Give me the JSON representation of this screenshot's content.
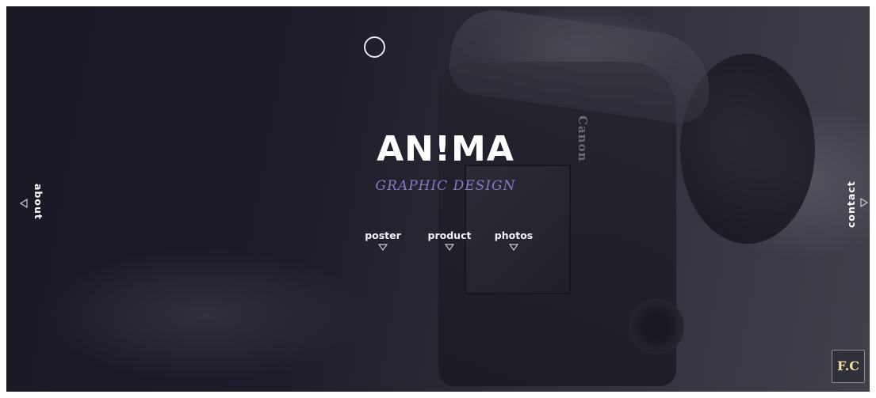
{
  "brand": {
    "logo_text": "AN!MA",
    "tagline": "GRAPHIC DESIGN",
    "badge_text": "F.C"
  },
  "nav": {
    "items": [
      {
        "label": "poster"
      },
      {
        "label": "product"
      },
      {
        "label": "photos"
      }
    ]
  },
  "side": {
    "left_label": "about",
    "right_label": "contact"
  },
  "background": {
    "camera_brand_text": "Canon"
  },
  "colors": {
    "tagline": "#8b76c8",
    "badge_text": "#f3dfa0",
    "text": "#ffffff",
    "overlay": "#141422"
  }
}
